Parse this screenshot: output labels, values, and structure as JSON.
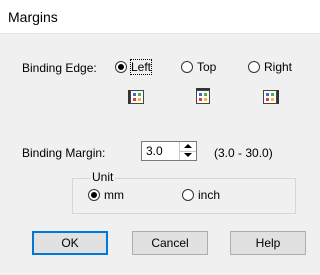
{
  "window": {
    "title": "Margins"
  },
  "binding_edge": {
    "label": "Binding Edge:",
    "options": [
      {
        "label": "Left",
        "selected": true,
        "icon": "binding-left-icon"
      },
      {
        "label": "Top",
        "selected": false,
        "icon": "binding-top-icon"
      },
      {
        "label": "Right",
        "selected": false,
        "icon": "binding-right-icon"
      }
    ]
  },
  "binding_margin": {
    "label": "Binding Margin:",
    "value": "3.0",
    "range": "(3.0 - 30.0)"
  },
  "unit": {
    "label": "Unit",
    "options": [
      {
        "label": "mm",
        "selected": true
      },
      {
        "label": "inch",
        "selected": false
      }
    ]
  },
  "buttons": {
    "ok": "OK",
    "cancel": "Cancel",
    "help": "Help"
  },
  "colors": {
    "default_button_border": "#0078d7",
    "background": "#f0f0f0"
  }
}
